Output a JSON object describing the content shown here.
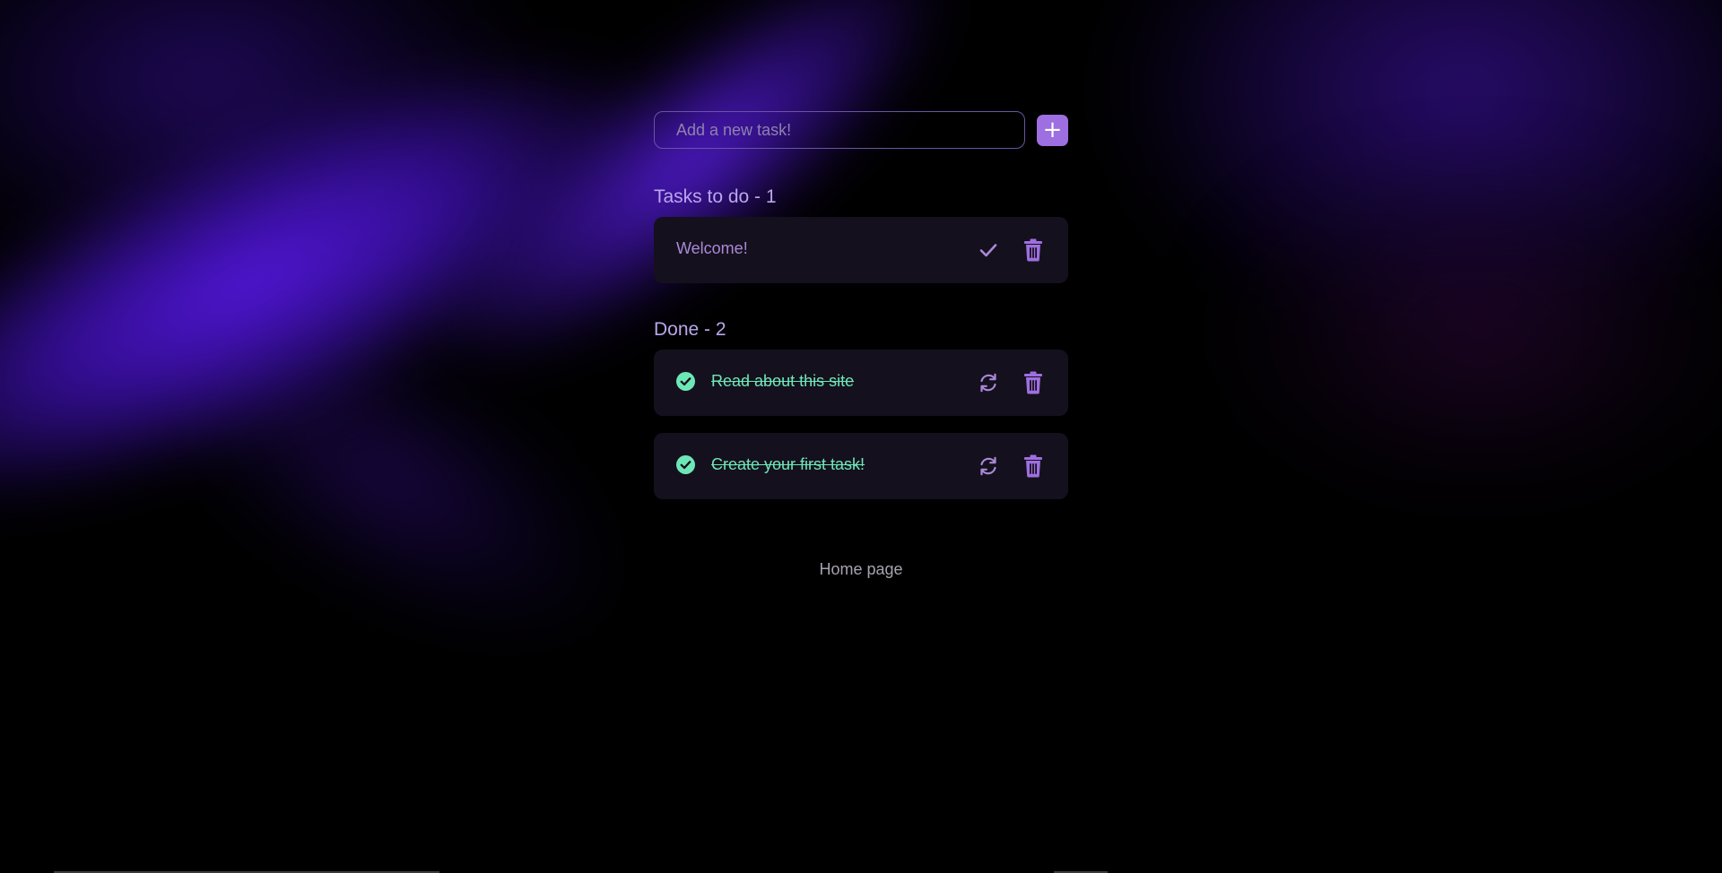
{
  "add_task": {
    "placeholder": "Add a new task!",
    "add_label": "+"
  },
  "todo": {
    "title": "Tasks to do - 1",
    "items": [
      {
        "text": "Welcome!"
      }
    ]
  },
  "done": {
    "title": "Done - 2",
    "items": [
      {
        "text": "Read about this site"
      },
      {
        "text": "Create your first task!"
      }
    ]
  },
  "footer": {
    "home_link": "Home page"
  },
  "colors": {
    "accent": "#9e6fe0",
    "done_text": "#6ee7b7",
    "card_bg": "#15101d"
  },
  "icons": {
    "check": "check-icon",
    "trash": "trash-icon",
    "refresh": "refresh-icon",
    "done_badge": "check-circle-icon"
  }
}
